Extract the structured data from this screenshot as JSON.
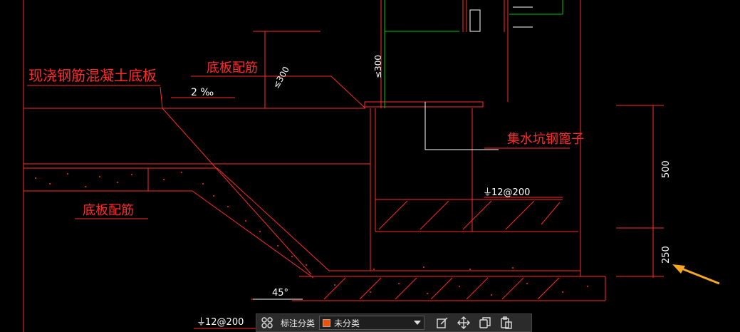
{
  "drawing": {
    "label_slab": "现浇钢筋混凝土底板",
    "label_rebar_top": "底板配筋",
    "label_rebar_left": "底板配筋",
    "label_grate": "集水坑钢篦子",
    "slope": "2 ‰",
    "dim_300_a": "≤300",
    "dim_300_b": "≤300",
    "dim_500": "500",
    "dim_250": "250",
    "rebar_spec_1": "12@200",
    "rebar_spec_2": "12@200",
    "angle": "45°"
  },
  "toolbar": {
    "category_label": "标注分类",
    "category_value": "未分类",
    "category_color": "#e8550a"
  },
  "colors": {
    "line_red": "#ff2a2a",
    "line_green": "#00c800",
    "line_white": "#ffffff",
    "arrow": "#f5a623"
  }
}
